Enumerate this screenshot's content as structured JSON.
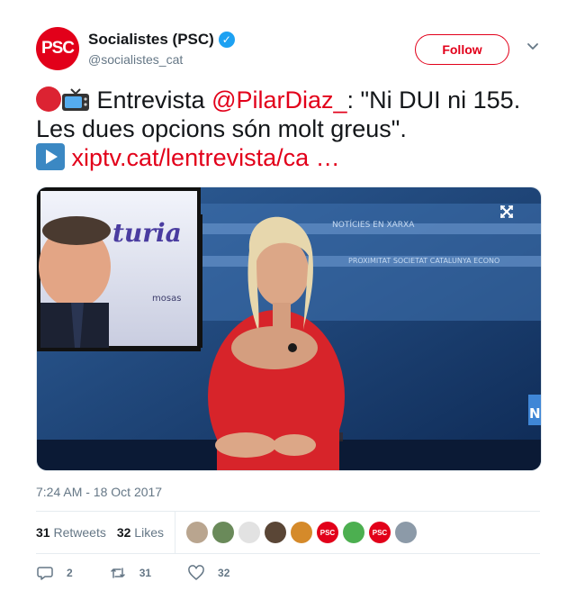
{
  "author": {
    "avatar_text": "PSC",
    "display_name": "Socialistes (PSC)",
    "handle": "@socialistes_cat",
    "verified": true
  },
  "follow_label": "Follow",
  "tweet": {
    "word_entrevista": "Entrevista",
    "mention": "@PilarDiaz_",
    "quote_text": ": \"Ni DUI ni 155. Les dues opcions són molt greus\".",
    "link_text": "xiptv.cat/lentrevista/ca",
    "ellipsis": "…"
  },
  "media": {
    "ticker_top": "NOTÍCIES EN XARXA",
    "ticker_bottom": "PROXIMITAT SOCIETAT CATALUNYA ECONO",
    "backdrop_text": "turia",
    "backdrop_small": "mosas",
    "channel_logo": "NV",
    "channel_logo_small": "N"
  },
  "timestamp": "7:24 AM - 18 Oct 2017",
  "stats": {
    "retweets_count": "31",
    "retweets_label": "Retweets",
    "likes_count": "32",
    "likes_label": "Likes"
  },
  "liker_faces": [
    {
      "text": "",
      "color": "#b9a58f"
    },
    {
      "text": "",
      "color": "#6a8a5a"
    },
    {
      "text": "",
      "color": "#e2e2e2"
    },
    {
      "text": "",
      "color": "#5a4636"
    },
    {
      "text": "",
      "color": "#d58a2a"
    },
    {
      "text": "PSC",
      "color": "#e2001a"
    },
    {
      "text": "",
      "color": "#4caf50"
    },
    {
      "text": "PSC",
      "color": "#e2001a"
    },
    {
      "text": "",
      "color": "#8c9aa8"
    }
  ],
  "actions": {
    "replies": "2",
    "retweets": "31",
    "likes": "32"
  },
  "colors": {
    "accent": "#e2001a",
    "muted": "#657786",
    "verified": "#1da1f2"
  }
}
